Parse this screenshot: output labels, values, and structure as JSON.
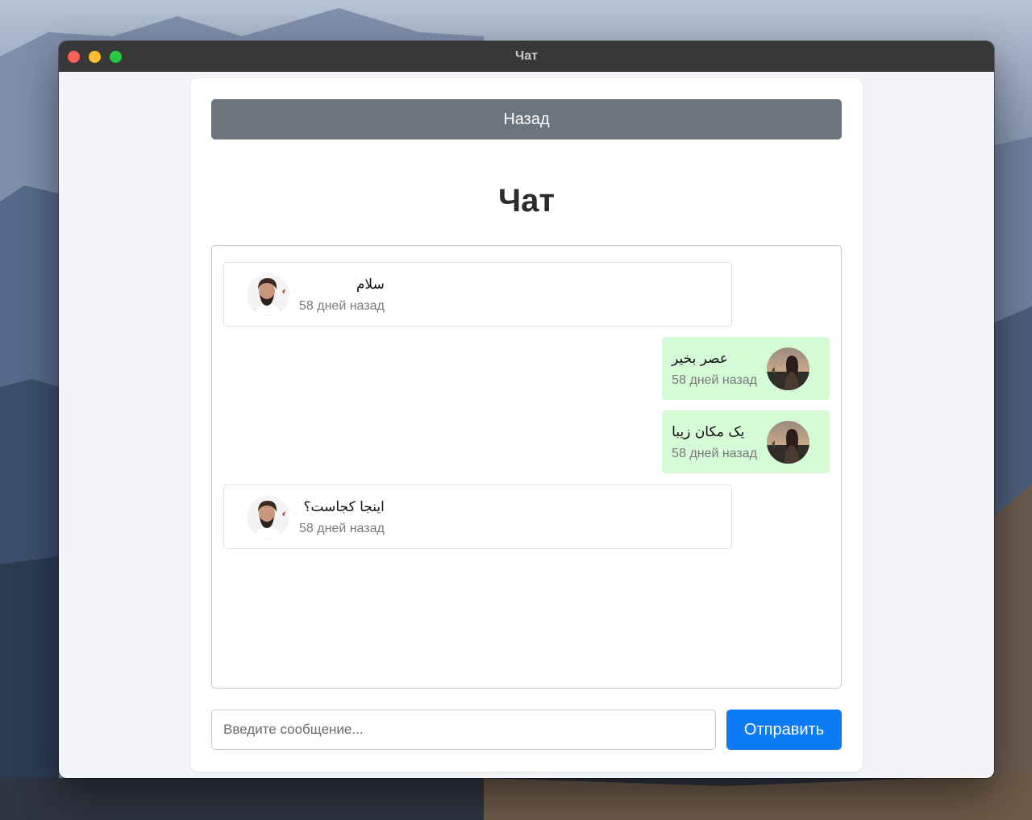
{
  "window": {
    "title": "Чат"
  },
  "header": {
    "back_label": "Назад",
    "title": "Чат"
  },
  "messages": [
    {
      "side": "left",
      "text": "سلام",
      "time": "58 дней назад",
      "avatar": "man-avatar"
    },
    {
      "side": "right",
      "text": "عصر بخیر",
      "time": "58 дней назад",
      "avatar": "woman-avatar"
    },
    {
      "side": "right",
      "text": "یک مکان زیبا",
      "time": "58 дней назад",
      "avatar": "woman-avatar"
    },
    {
      "side": "left",
      "text": "اینجا کجاست؟",
      "time": "58 дней назад",
      "avatar": "man-avatar"
    }
  ],
  "composer": {
    "placeholder": "Введите сообщение...",
    "value": "",
    "send_label": "Отправить"
  },
  "colors": {
    "back_button": "#6c757d",
    "send_button": "#0d7bf5",
    "outgoing_bubble": "#d4fad6",
    "incoming_bubble": "#ffffff"
  }
}
